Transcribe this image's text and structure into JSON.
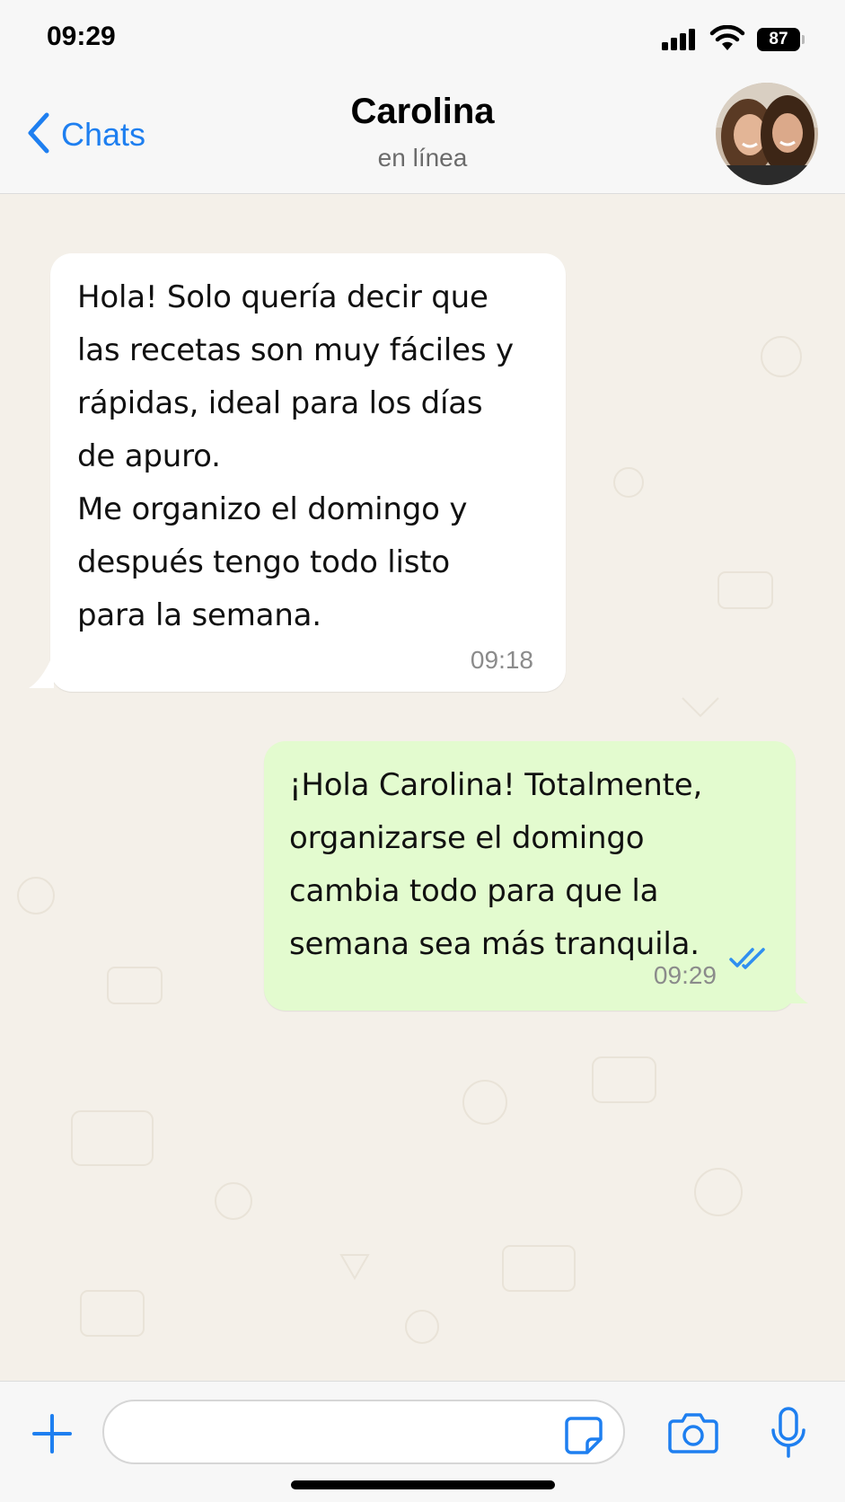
{
  "status_bar": {
    "time": "09:29",
    "battery": "87"
  },
  "header": {
    "back_label": "Chats",
    "contact_name": "Carolina",
    "contact_status": "en línea"
  },
  "messages": [
    {
      "direction": "incoming",
      "text": "Hola! Solo quería decir que\nlas recetas son muy fáciles y\nrápidas, ideal para los días\nde apuro.\nMe organizo el domingo y\ndespués tengo todo listo\npara la semana.",
      "time": "09:18"
    },
    {
      "direction": "outgoing",
      "text": "¡Hola Carolina! Totalmente,\norganizarse el domingo\ncambia todo para que la\nsemana sea más tranquila.",
      "time": "09:29",
      "status_icon": "double-check-read-icon"
    }
  ],
  "input_bar": {
    "icons": [
      "plus-icon",
      "sticker-icon",
      "camera-icon",
      "microphone-icon"
    ]
  },
  "colors": {
    "accent": "#1e7ff0",
    "incoming_bubble": "#ffffff",
    "outgoing_bubble": "#e3fbcf",
    "chat_background": "#f4f0e9"
  }
}
